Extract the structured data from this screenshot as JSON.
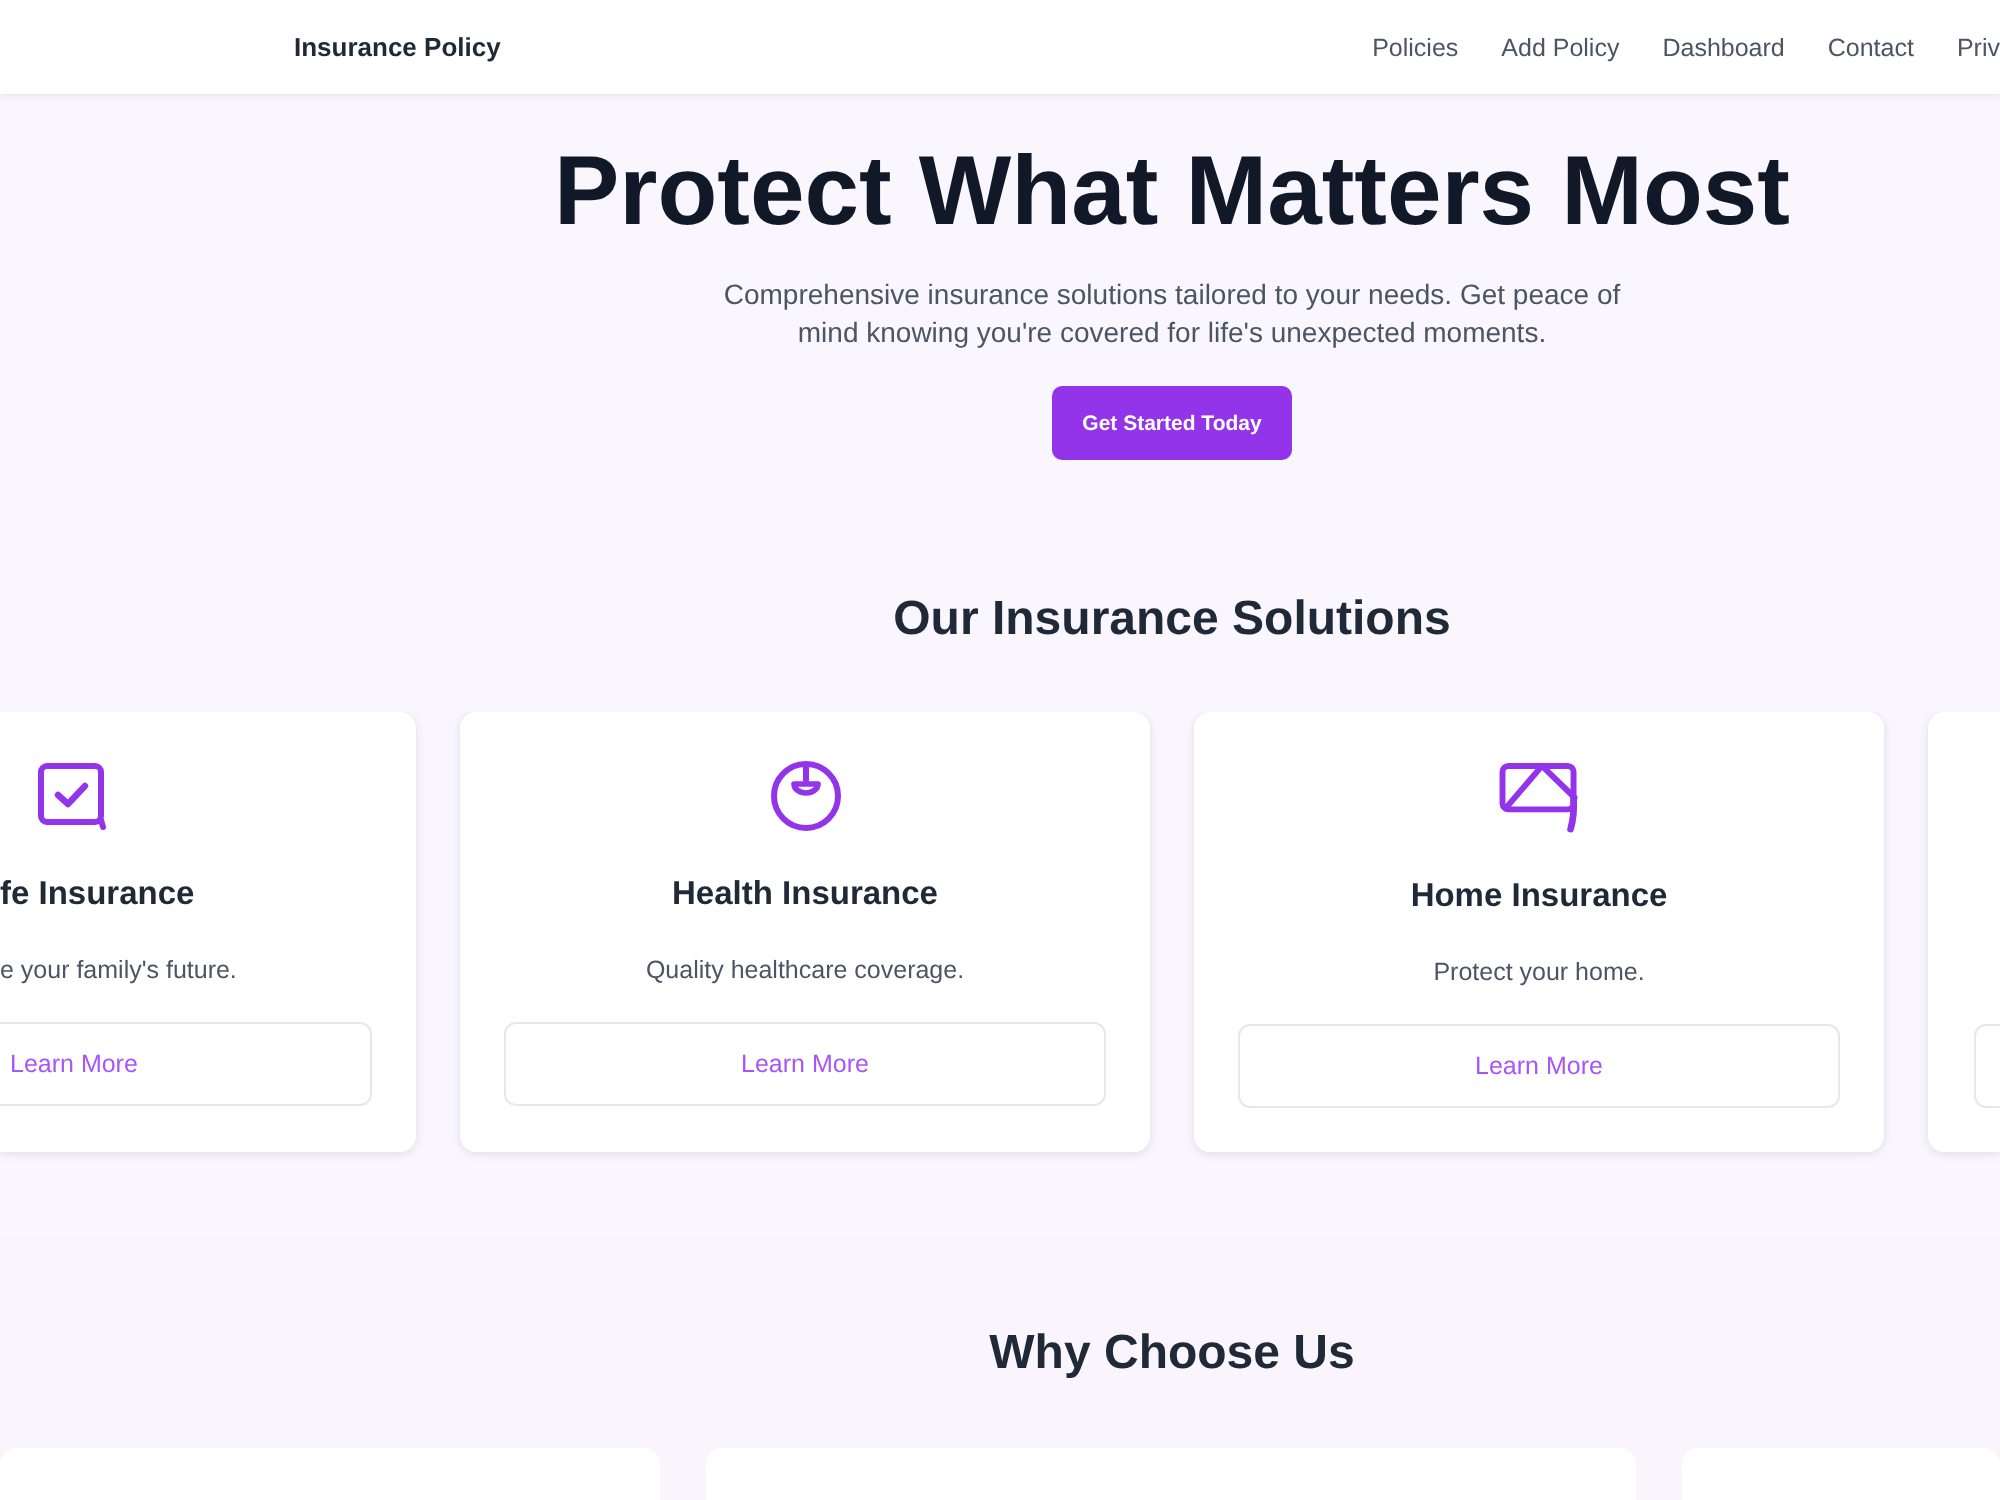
{
  "navbar": {
    "brand": "Insurance Policy",
    "links": [
      "Policies",
      "Add Policy",
      "Dashboard",
      "Contact",
      "Priv"
    ]
  },
  "hero": {
    "title": "Protect What Matters Most",
    "subtitle": "Comprehensive insurance solutions tailored to your needs. Get peace of mind knowing you're covered for life's unexpected moments.",
    "button": "Get Started Today"
  },
  "solutions": {
    "heading": "Our Insurance Solutions",
    "cards": [
      {
        "kind": "clipped-left",
        "title": "fe Insurance",
        "description": "e your family's future.",
        "button": "Learn More"
      },
      {
        "kind": "full",
        "title": "Health Insurance",
        "description": "Quality healthcare coverage.",
        "button": "Learn More"
      },
      {
        "kind": "full",
        "title": "Home Insurance",
        "description": "Protect your home.",
        "button": "Learn More"
      },
      {
        "kind": "clipped-right"
      }
    ]
  },
  "why": {
    "heading": "Why Choose Us"
  }
}
